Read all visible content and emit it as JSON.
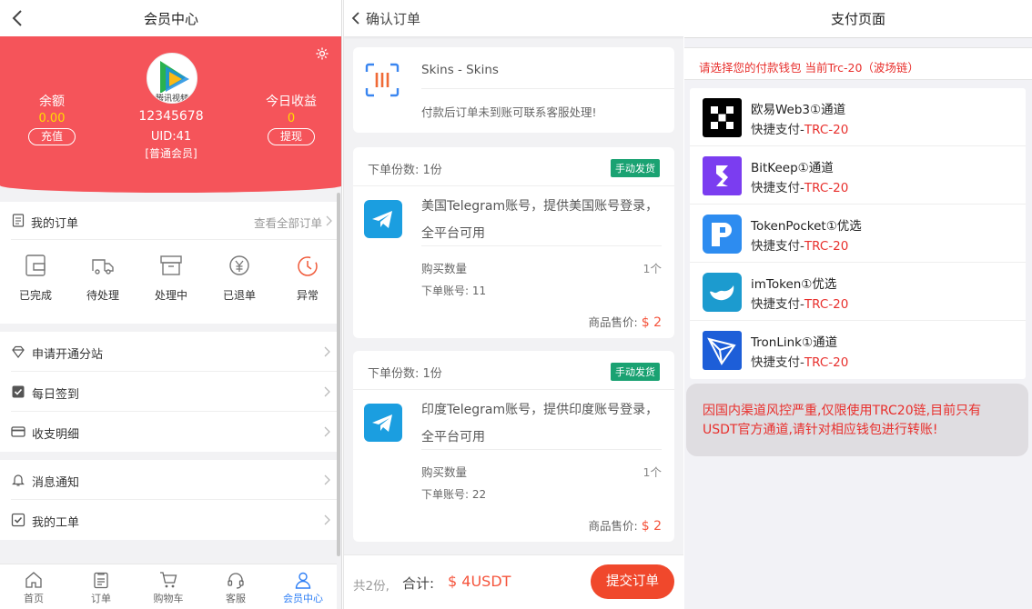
{
  "member_center": {
    "title": "会员中心",
    "balance_label": "余额",
    "balance_value": "0.00",
    "recharge_label": "充值",
    "username": "12345678",
    "uid": "UID:41",
    "level": "[普通会员]",
    "avatar_text": "腾讯视频",
    "today_income_label": "今日收益",
    "today_income_value": "0",
    "withdraw_label": "提现",
    "my_orders_label": "我的订单",
    "view_all_orders": "查看全部订单",
    "order_status": [
      "已完成",
      "待处理",
      "处理中",
      "已退单",
      "异常"
    ],
    "menu_group_1": [
      "申请开通分站",
      "每日签到",
      "收支明细"
    ],
    "menu_group_2": [
      "消息通知",
      "我的工单"
    ],
    "tabbar": [
      "首页",
      "订单",
      "购物车",
      "客服",
      "会员中心"
    ]
  },
  "confirm_order": {
    "title": "确认订单",
    "product_title": "Skins - Skins",
    "product_note": "付款后订单未到账可联系客服处理!",
    "orders": [
      {
        "qty_label": "下单份数: 1份",
        "badge": "手动发货",
        "description": "美国Telegram账号，提供美国账号登录，全平台可用",
        "buy_qty_label": "购买数量",
        "buy_qty_value": "1个",
        "account_label": "下单账号: 11",
        "price_label": "商品售价:",
        "price_value": "$ 2"
      },
      {
        "qty_label": "下单份数: 1份",
        "badge": "手动发货",
        "description": "印度Telegram账号，提供印度账号登录，全平台可用",
        "buy_qty_label": "购买数量",
        "buy_qty_value": "1个",
        "account_label": "下单账号: 22",
        "price_label": "商品售价:",
        "price_value": "$ 2"
      }
    ],
    "footer_count": "共2份,",
    "footer_total_label": "合计:",
    "footer_amount": "$ 4USDT",
    "submit_label": "提交订单"
  },
  "payment": {
    "title": "支付页面",
    "notice": "请选择您的付款钱包 当前Trc-20（波场链）",
    "wallets": [
      {
        "name": "欧易Web3①通道",
        "sub_prefix": "快捷支付-",
        "sub_chain": "TRC-20",
        "icon": "okx-icon"
      },
      {
        "name": "BitKeep①通道",
        "sub_prefix": "快捷支付-",
        "sub_chain": "TRC-20",
        "icon": "bitkeep-icon"
      },
      {
        "name": "TokenPocket①优选",
        "sub_prefix": "快捷支付-",
        "sub_chain": "TRC-20",
        "icon": "tokenpocket-icon"
      },
      {
        "name": "imToken①优选",
        "sub_prefix": "快捷支付-",
        "sub_chain": "TRC-20",
        "icon": "imtoken-icon"
      },
      {
        "name": "TronLink①通道",
        "sub_prefix": "快捷支付-",
        "sub_chain": "TRC-20",
        "icon": "tronlink-icon"
      }
    ],
    "warning": "因国内渠道风控严重,仅限使用TRC20链,目前只有USDT官方通道,请针对相应钱包进行转账!"
  },
  "colors": {
    "brand_red": "#f5545a",
    "price_red": "#f5543c",
    "badge_green": "#1aa272",
    "tab_active": "#2f7ff5",
    "submit": "#f0482c"
  }
}
